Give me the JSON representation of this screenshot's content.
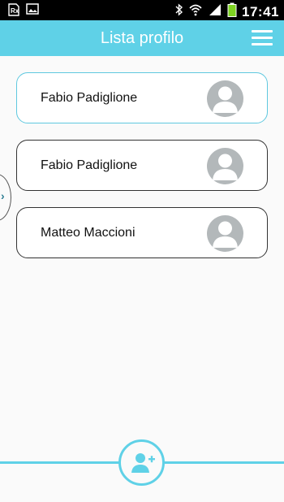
{
  "status_bar": {
    "time": "17:41",
    "icons": [
      "rx-notification-icon",
      "image-notification-icon",
      "bluetooth-icon",
      "wifi-icon",
      "signal-icon",
      "battery-icon"
    ]
  },
  "header": {
    "title": "Lista profilo",
    "menu_icon": "hamburger-menu-icon"
  },
  "profiles": [
    {
      "name": "Fabio Padiglione",
      "avatar_icon": "user-avatar-icon",
      "selected": true
    },
    {
      "name": "Fabio Padiglione",
      "avatar_icon": "user-avatar-icon",
      "selected": false
    },
    {
      "name": "Matteo Maccioni",
      "avatar_icon": "user-avatar-icon",
      "selected": false
    }
  ],
  "drawer": {
    "icon": "chevron-right-icon"
  },
  "bottom": {
    "add_icon": "add-user-icon"
  },
  "colors": {
    "accent": "#5fd1e7",
    "avatar_gray": "#b3b8ba",
    "status_bar": "#000000",
    "battery": "#7ed321"
  }
}
